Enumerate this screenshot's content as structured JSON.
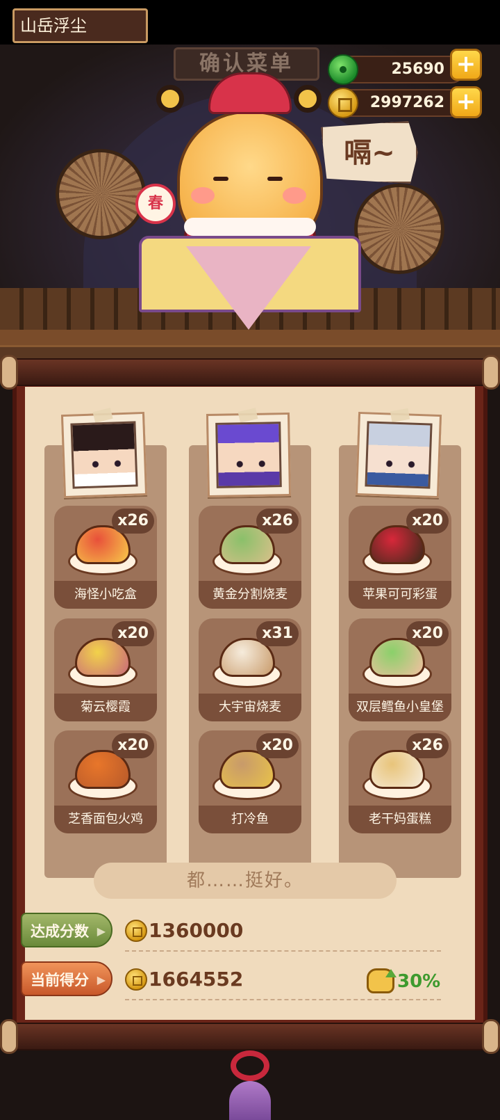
{
  "header": {
    "player_name": "山岳浮尘",
    "sign_text": "确认菜单",
    "jade_amount": "25690",
    "coin_amount": "2997262",
    "add_label": "+"
  },
  "scene": {
    "drum_text": "春",
    "speech_bubble": "嗝~"
  },
  "columns": [
    {
      "character": "character-1",
      "dishes": [
        {
          "name": "海怪小吃盒",
          "count": "x26"
        },
        {
          "name": "菊云樱霞",
          "count": "x20"
        },
        {
          "name": "芝香面包火鸡",
          "count": "x20"
        }
      ]
    },
    {
      "character": "character-2",
      "dishes": [
        {
          "name": "黄金分割烧麦",
          "count": "x26"
        },
        {
          "name": "大宇宙烧麦",
          "count": "x31"
        },
        {
          "name": "打冷鱼",
          "count": "x20"
        }
      ]
    },
    {
      "character": "character-3",
      "dishes": [
        {
          "name": "苹果可可彩蛋",
          "count": "x20"
        },
        {
          "name": "双层鳕鱼小皇堡",
          "count": "x20"
        },
        {
          "name": "老干妈蛋糕",
          "count": "x26"
        }
      ]
    }
  ],
  "comment": "都……挺好。",
  "scores": {
    "target_label": "达成分数",
    "target_value": "1360000",
    "current_label": "当前得分",
    "current_value": "1664552",
    "bonus_value": "30%"
  },
  "colors": {
    "panel": "#f0dbbd",
    "dish_card": "#9b7158",
    "bonus_green": "#3e9a2e",
    "target_tag": "#6a8a3a",
    "current_tag": "#c8582a"
  },
  "food_colors": [
    [
      "#e8503a",
      "#f7c94a"
    ],
    [
      "#8ac06a",
      "#d9c08a"
    ],
    [
      "#d8283a",
      "#3a2a1a"
    ],
    [
      "#f2d24a",
      "#c86a7a"
    ],
    [
      "#f6ecdc",
      "#c89a6a"
    ],
    [
      "#8ad06a",
      "#f2c0a0"
    ],
    [
      "#e8762a",
      "#b85a2a"
    ],
    [
      "#c89a6a",
      "#e8c24a"
    ],
    [
      "#e8c47a",
      "#f6ecdc"
    ]
  ]
}
